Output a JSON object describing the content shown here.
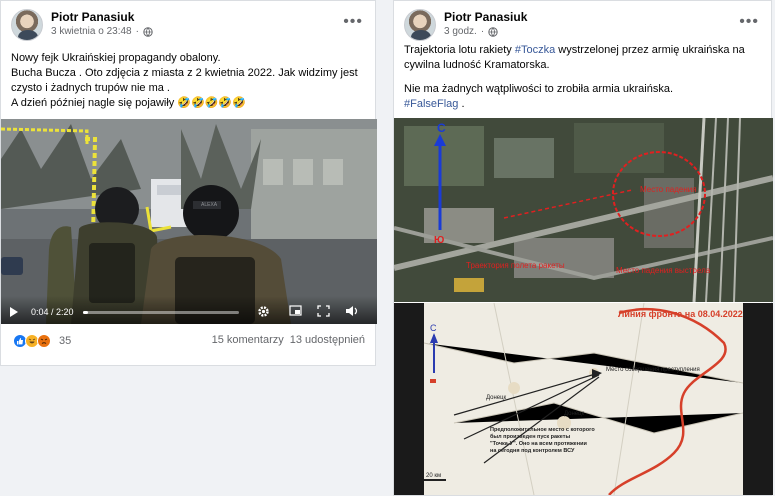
{
  "post1": {
    "author": "Piotr Panasiuk",
    "timestamp": "3 kwietnia o 23:48",
    "separator": "·",
    "text_lines": [
      "Nowy fejk Ukraińskiej propagandy obalony.",
      "Bucha Bucza . Oto zdjęcia z miasta z 2 kwietnia 2022. Jak widzimy  jest",
      "czysto i żadnych trupów nie ma .",
      "A dzień później nagle się pojawiły 🤣🤣🤣🤣🤣"
    ],
    "video": {
      "time_current": "0:04",
      "time_sep": " / ",
      "time_total": "2:20",
      "progress_fraction": 0.03,
      "vehicle_text": "ALEXA"
    },
    "reactions": {
      "count": "35",
      "icons": [
        "like-icon",
        "haha-icon",
        "angry-icon"
      ]
    },
    "comments": "15 komentarzy",
    "shares": "13 udostępnień"
  },
  "post2": {
    "author": "Piotr Panasiuk",
    "timestamp": "3 godz.",
    "separator": "·",
    "line1_before": "Trajektoria lotu rakiety ",
    "line1_hashtag": "#Toczka",
    "line1_after": " wystrzelonej przez armię ukraińska na",
    "line2": "cywilna ludność Kramatorska.",
    "line3": "Nie ma żadnych wątpliwości to zrobiła armia ukraińska.",
    "hashtag2": "#FalseFlag",
    "hashtag2_after": " .",
    "map1": {
      "north": "C",
      "south": "Ю",
      "label_center": "Место падения",
      "label_left": "Траектория полета ракеты",
      "label_right": "Место падения выстрела"
    },
    "map2": {
      "title": "Линия фронта на 08.04.2022",
      "north": "С",
      "label_crime": "Место совершения преступления",
      "label_launch": "Предположительное место с которого был произведен пуск ракеты \"Точка-У\". Оно на всем протяжении на сегодня под контролем ВСУ",
      "town1": "Донецк",
      "town2": "Донецк",
      "scale": "20 км"
    }
  },
  "colors": {
    "link": "#385898",
    "muted": "#65676b",
    "like": "#1877f2",
    "angry": "#e9710f",
    "haha": "#f7b125"
  }
}
